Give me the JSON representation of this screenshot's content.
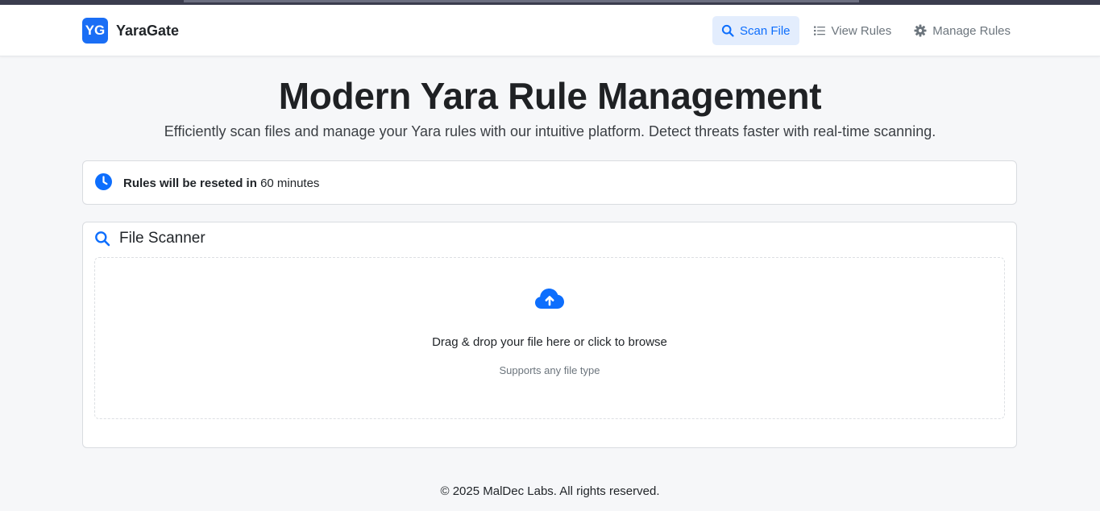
{
  "brand": {
    "logo_text": "YG",
    "name": "YaraGate"
  },
  "nav": {
    "scan_file": "Scan File",
    "view_rules": "View Rules",
    "manage_rules": "Manage Rules",
    "active": "scan_file"
  },
  "hero": {
    "title": "Modern Yara Rule Management",
    "subtitle": "Efficiently scan files and manage your Yara rules with our intuitive platform. Detect threats faster with real-time scanning."
  },
  "timer": {
    "label": "Rules will be reseted in",
    "value": "60 minutes"
  },
  "scanner": {
    "title": "File Scanner",
    "drop_text": "Drag & drop your file here or click to browse",
    "drop_hint": "Supports any file type"
  },
  "footer": {
    "text": "© 2025 MalDec Labs. All rights reserved."
  },
  "icons": {
    "nav_scan": "search-icon",
    "nav_view": "list-icon",
    "nav_manage": "gear-icon",
    "timer": "clock-icon",
    "scanner": "search-icon",
    "upload": "cloud-upload-icon"
  },
  "colors": {
    "accent": "#0d6efd",
    "brand_logo_bg": "#1a6ef5",
    "active_nav_bg": "#e3edfd",
    "page_bg": "#f6f7f9"
  }
}
